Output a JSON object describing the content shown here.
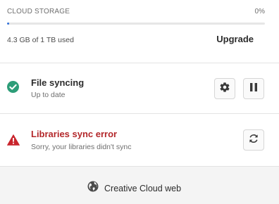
{
  "storage": {
    "title": "CLOUD STORAGE",
    "percent_label": "0%",
    "used_fraction": 0.0043,
    "used_label": "4.3 GB of 1 TB used",
    "upgrade_label": "Upgrade",
    "bar_color": "#2d6fda"
  },
  "file_sync": {
    "title": "File syncing",
    "status": "Up to date",
    "icon": "check-circle-icon",
    "icon_color": "#2d9d78",
    "actions": [
      "gear-icon",
      "pause-icon"
    ]
  },
  "libraries": {
    "title": "Libraries sync error",
    "status": "Sorry, your libraries didn't sync",
    "icon": "warning-icon",
    "title_color": "#b3272a",
    "icon_color": "#c9252d",
    "actions": [
      "refresh-icon"
    ]
  },
  "footer": {
    "link_label": "Creative Cloud web",
    "icon": "globe-icon"
  }
}
